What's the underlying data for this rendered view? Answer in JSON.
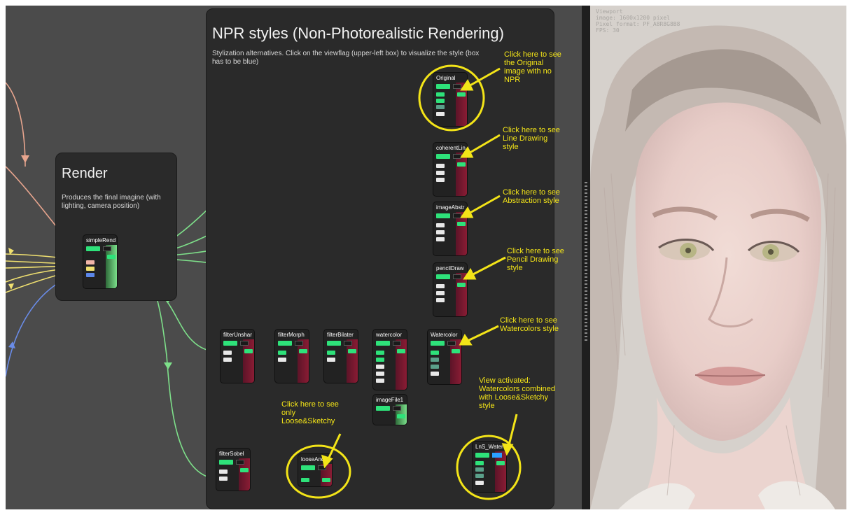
{
  "render_frame": {
    "title": "Render",
    "description": "Produces the final imagine (with lighting, camera position)"
  },
  "npr_frame": {
    "title": "NPR styles (Non-Photorealistic Rendering)",
    "description": "Stylization alternatives. Click on the viewflag (upper-left box) to visualize the style (box has to be blue)"
  },
  "nodes": {
    "simple_render": "simpleRend",
    "original": "Original",
    "coherent_lines": "coherentLin",
    "image_abstraction": "imageAbstr",
    "pencil_drawing": "pencilDraw",
    "filter_unsharp": "filterUnshar",
    "filter_morpho": "filterMorph",
    "filter_bilateral": "filterBilater",
    "watercolor_lower": "watercolor",
    "watercolor": "Watercolor",
    "image_file": "imageFile1",
    "filter_sobel": "filterSobel",
    "loose_and_sketchy": "looseAndS",
    "lns_water": "LnS_Water"
  },
  "annotations": {
    "original": "Click here to see\nthe Original\nimage with no\nNPR",
    "line_drawing": "Click here to see\nLine Drawing\nstyle",
    "abstraction": "Click here to see\nAbstraction style",
    "pencil": "Click here to see\nPencil Drawing\nstyle",
    "watercolors": "Click here to see\nWatercolors style",
    "view_activated": "View activated:\nWatercolors combined\nwith Loose&Sketchy\nstyle",
    "loose_sketchy": "Click here to see\nonly\nLoose&Sketchy"
  },
  "viewport": {
    "info_title": "Viewport",
    "info_image": "image: 1600x1200 pixel",
    "info_format": "Pixel format: PF_A8R8G8B8",
    "info_fps": "FPS: 30"
  },
  "colors": {
    "graph_bg": "#4b4b4b",
    "frame_bg": "#2a2a2a",
    "wire_green": "#7ee08a",
    "annotation_yellow": "#f3e418",
    "viewflag_active": "#2aa0ff"
  }
}
